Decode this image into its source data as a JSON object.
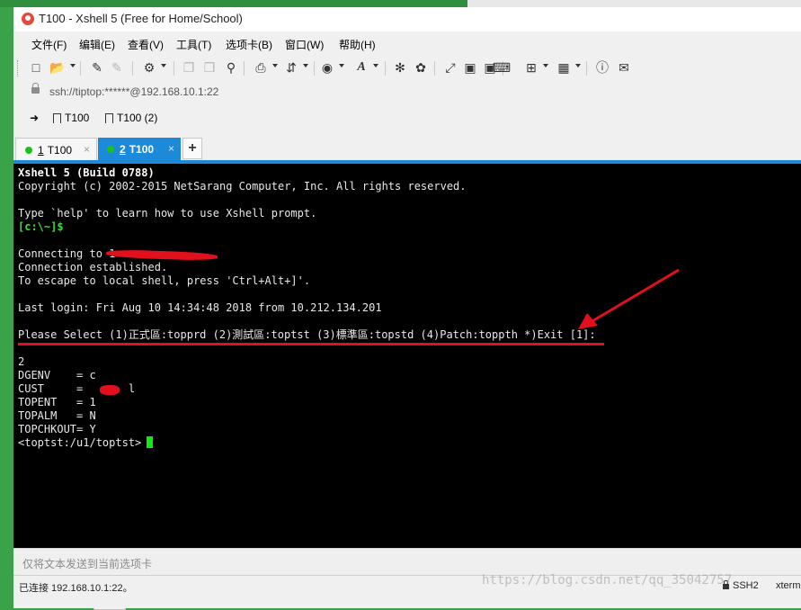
{
  "window": {
    "title": "T100 - Xshell 5 (Free for Home/School)"
  },
  "menu": {
    "items": [
      "文件(F)",
      "编辑(E)",
      "查看(V)",
      "工具(T)",
      "选项卡(B)",
      "窗口(W)",
      "帮助(H)"
    ]
  },
  "toolbar": {
    "icons": [
      "new-session-icon",
      "open-folder-icon",
      "reconnect-icon",
      "disconnect-icon",
      "properties-icon",
      "copy-icon",
      "paste-icon",
      "find-icon",
      "print-icon",
      "transfer-icon",
      "terminal-type-icon",
      "globe-icon",
      "font-icon",
      "xftp-icon",
      "xmanager-icon",
      "fullscreen-icon",
      "lock-screen-icon",
      "lock-icon",
      "keyboard-icon",
      "new-tab-icon",
      "layout-icon",
      "help-icon",
      "chat-icon"
    ]
  },
  "address": {
    "text": "ssh://tiptop:******@192.168.10.1:22"
  },
  "links": {
    "items": [
      "T100",
      "T100 (2)"
    ]
  },
  "tabs": {
    "items": [
      {
        "number": "1",
        "label": "T100"
      },
      {
        "number": "2",
        "label": "T100"
      }
    ],
    "add_label": "+"
  },
  "terminal": {
    "line1": "Xshell 5 (Build 0788)",
    "line2": "Copyright (c) 2002-2015 NetSarang Computer, Inc. All rights reserved.",
    "line3": "Type `help' to learn how to use Xshell prompt.",
    "line4": "[c:\\~]$",
    "line5": "Connecting to 1",
    "line6": "Connection established.",
    "line7": "To escape to local shell, press 'Ctrl+Alt+]'.",
    "line8": "Last login: Fri Aug 10 14:34:48 2018 from 10.212.134.201",
    "line9": "Please Select (1)正式區:topprd (2)測試區:toptst (3)標準區:topstd (4)Patch:toppth *)Exit [1]:",
    "line10": "2",
    "line11": "DGENV    = c",
    "line12": "CUST     =       l",
    "line13": "TOPENT   = 1",
    "line14": "TOPALM   = N",
    "line15": "TOPCHKOUT= Y",
    "line16": "<toptst:/u1/toptst>"
  },
  "compose": {
    "placeholder": "仅将文本发送到当前选项卡"
  },
  "status": {
    "connection": "已连接 192.168.10.1:22。",
    "protocol": "SSH2",
    "terminal_type": "xterm"
  },
  "watermark": "https://blog.csdn.net/qq_35042757",
  "colors": {
    "accent": "#1c8ad8",
    "terminal_bg": "#000000",
    "annotation": "#e20f1c",
    "session_dot": "#19c219"
  }
}
